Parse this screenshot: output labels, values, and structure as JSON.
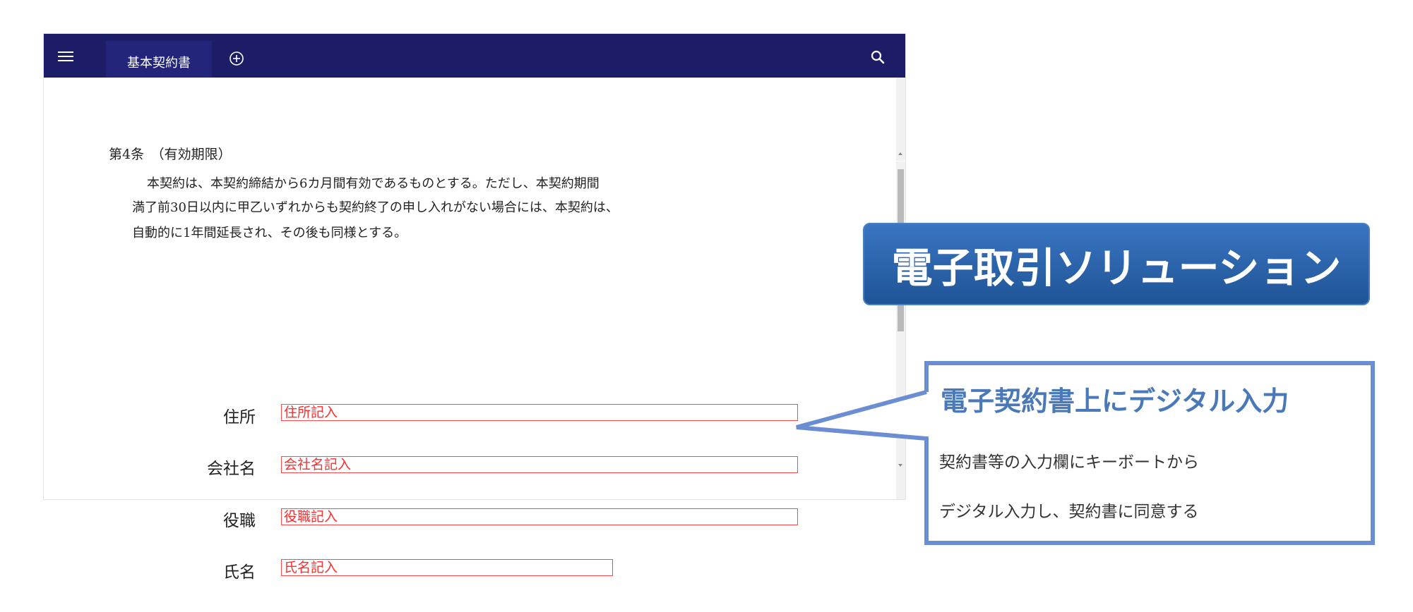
{
  "app": {
    "tab_label": "基本契約書",
    "icons": {
      "menu": "hamburger-menu-icon",
      "add_tab": "plus-circle-icon",
      "search": "search-icon"
    },
    "colors": {
      "header_bg": "#1c1d66",
      "tab_bg": "#22257a"
    }
  },
  "document": {
    "article_title": "第4条　（有効期限）",
    "paragraph_lines": [
      "本契約は、本契約締結から6カ月間有効であるものとする。ただし、本契約期間",
      "満了前30日以内に甲乙いずれからも契約終了の申し入れがない場合には、本契約は、",
      "自動的に1年間延長され、その後も同様とする。"
    ]
  },
  "form": {
    "fields": [
      {
        "label": "住所",
        "value": "住所記入"
      },
      {
        "label": "会社名",
        "value": "会社名記入"
      },
      {
        "label": "役職",
        "value": "役職記入"
      },
      {
        "label": "氏名",
        "value": "氏名記入"
      }
    ],
    "colors": {
      "field_border": "#ff4a4a",
      "field_text": "#ff2d2d"
    }
  },
  "banner": {
    "title": "電子取引ソリューション",
    "colors": {
      "top": "#3a75c2",
      "bottom": "#1f5496"
    }
  },
  "callout": {
    "title": "電子契約書上にデジタル入力",
    "lines": [
      "契約書等の入力欄にキーボートから",
      "デジタル入力し、契約書に同意する"
    ],
    "colors": {
      "border": "#6b8ed2",
      "title": "#4a79b8"
    }
  }
}
